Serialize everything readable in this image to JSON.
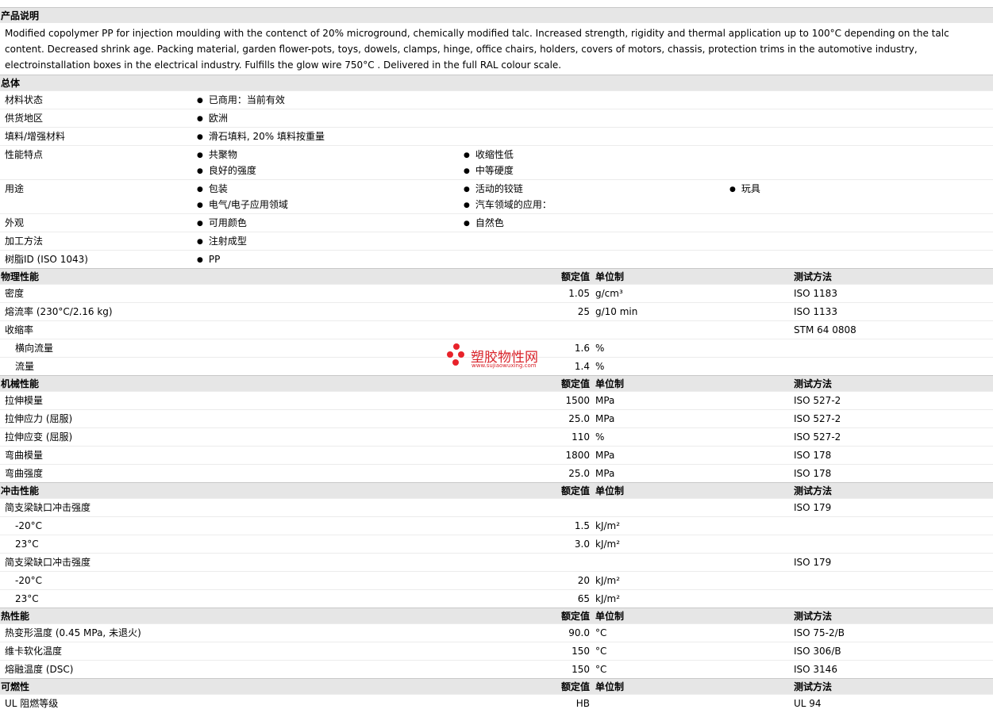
{
  "product": {
    "title": "产品说明",
    "description": "Modified copolymer PP for injection moulding with the contenct of 20% microground, chemically modified talc. Increased strength, rigidity and thermal application up to 100°C depending on the talc content. Decreased shrink age. Packing material, garden flower-pots, toys, dowels, clamps, hinge, office chairs, holders, covers of motors, chassis, protection trims in the automotive industry, electroinstallation boxes in the electrical industry. Fulfills the glow wire 750°C . Delivered in the full RAL colour scale."
  },
  "general": {
    "title": "总体",
    "rows": [
      {
        "label": "材料状态",
        "c1": [
          "已商用：当前有效"
        ],
        "c2": [],
        "c3": []
      },
      {
        "label": "供货地区",
        "c1": [
          "欧洲"
        ],
        "c2": [],
        "c3": []
      },
      {
        "label": "填料/增强材料",
        "c1": [
          "滑石填料, 20% 填料按重量"
        ],
        "c2": [],
        "c3": []
      },
      {
        "label": "性能特点",
        "c1": [
          "共聚物",
          "良好的强度"
        ],
        "c2": [
          "收缩性低",
          "中等硬度"
        ],
        "c3": []
      },
      {
        "label": "用途",
        "c1": [
          "包装",
          "电气/电子应用领域"
        ],
        "c2": [
          "活动的铰链",
          "汽车领域的应用："
        ],
        "c3": [
          "玩具"
        ]
      },
      {
        "label": "外观",
        "c1": [
          "可用颜色"
        ],
        "c2": [
          "自然色"
        ],
        "c3": []
      },
      {
        "label": "加工方法",
        "c1": [
          "注射成型"
        ],
        "c2": [],
        "c3": []
      },
      {
        "label": "树脂ID (ISO 1043)",
        "c1": [
          "PP"
        ],
        "c2": [],
        "c3": []
      }
    ]
  },
  "columns": {
    "value": "额定值",
    "unit": "单位制",
    "method": "测试方法"
  },
  "sections": [
    {
      "title": "物理性能",
      "rows": [
        {
          "label": "密度",
          "indent": false,
          "value": "1.05",
          "unit": "g/cm³",
          "method": "ISO 1183"
        },
        {
          "label": "熔流率  (230°C/2.16 kg)",
          "indent": false,
          "value": "25",
          "unit": "g/10 min",
          "method": "ISO 1133"
        },
        {
          "label": "收缩率",
          "indent": false,
          "value": "",
          "unit": "",
          "method": "STM 64 0808"
        },
        {
          "label": "横向流量",
          "indent": true,
          "value": "1.6",
          "unit": "%",
          "method": ""
        },
        {
          "label": "流量",
          "indent": true,
          "value": "1.4",
          "unit": "%",
          "method": ""
        }
      ]
    },
    {
      "title": "机械性能",
      "rows": [
        {
          "label": "拉伸模量",
          "indent": false,
          "value": "1500",
          "unit": "MPa",
          "method": "ISO 527-2"
        },
        {
          "label": "拉伸应力  (屈服)",
          "indent": false,
          "value": "25.0",
          "unit": "MPa",
          "method": "ISO 527-2"
        },
        {
          "label": "拉伸应变  (屈服)",
          "indent": false,
          "value": "110",
          "unit": "%",
          "method": "ISO 527-2"
        },
        {
          "label": "弯曲模量",
          "indent": false,
          "value": "1800",
          "unit": "MPa",
          "method": "ISO 178"
        },
        {
          "label": "弯曲强度",
          "indent": false,
          "value": "25.0",
          "unit": "MPa",
          "method": "ISO 178"
        }
      ]
    },
    {
      "title": "冲击性能",
      "rows": [
        {
          "label": "简支梁缺口冲击强度",
          "indent": false,
          "value": "",
          "unit": "",
          "method": "ISO 179"
        },
        {
          "label": "-20°C",
          "indent": true,
          "value": "1.5",
          "unit": "kJ/m²",
          "method": ""
        },
        {
          "label": "23°C",
          "indent": true,
          "value": "3.0",
          "unit": "kJ/m²",
          "method": ""
        },
        {
          "label": "简支梁缺口冲击强度",
          "indent": false,
          "value": "",
          "unit": "",
          "method": "ISO 179"
        },
        {
          "label": "-20°C",
          "indent": true,
          "value": "20",
          "unit": "kJ/m²",
          "method": ""
        },
        {
          "label": "23°C",
          "indent": true,
          "value": "65",
          "unit": "kJ/m²",
          "method": ""
        }
      ]
    },
    {
      "title": "热性能",
      "rows": [
        {
          "label": "热变形温度  (0.45 MPa, 未退火)",
          "indent": false,
          "value": "90.0",
          "unit": "°C",
          "method": "ISO 75-2/B"
        },
        {
          "label": "维卡软化温度",
          "indent": false,
          "value": "150",
          "unit": "°C",
          "method": "ISO 306/B"
        },
        {
          "label": "熔融温度  (DSC)",
          "indent": false,
          "value": "150",
          "unit": "°C",
          "method": "ISO 3146"
        }
      ]
    },
    {
      "title": "可燃性",
      "rows": [
        {
          "label": "UL 阻燃等级",
          "indent": false,
          "value": "HB",
          "unit": "",
          "method": "UL 94"
        }
      ]
    }
  ],
  "watermark": {
    "title": "塑胶物性网",
    "url": "www.sujiaowuxing.com",
    "color": "#e8222a"
  }
}
